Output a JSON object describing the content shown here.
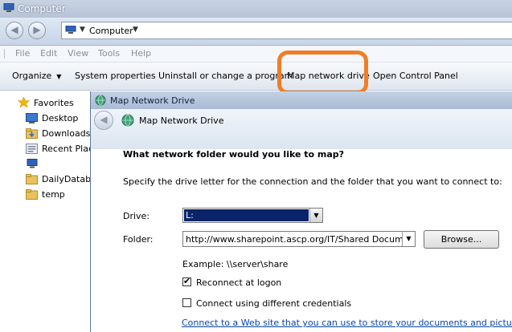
{
  "window": {
    "title": "Computer"
  },
  "address": {
    "location": "Computer"
  },
  "menu": [
    "File",
    "Edit",
    "View",
    "Tools",
    "Help"
  ],
  "commands": {
    "organize": "Organize",
    "system_properties": "System properties",
    "uninstall": "Uninstall or change a program",
    "map_drive": "Map network drive",
    "control_panel": "Open Control Panel"
  },
  "nav": {
    "favorites": "Favorites",
    "items": [
      "Desktop",
      "Downloads",
      "Recent Places",
      "",
      "DailyDatabase",
      "temp"
    ]
  },
  "dialog": {
    "title": "Map Network Drive",
    "header": "Map Network Drive",
    "question": "What network folder would you like to map?",
    "instructions": "Specify the drive letter for the connection and the folder that you want to connect to:",
    "drive_label": "Drive:",
    "drive_value": "L:",
    "folder_label": "Folder:",
    "folder_value": "http://www.sharepoint.ascp.org/IT/Shared Documents",
    "browse": "Browse...",
    "example": "Example: \\\\server\\share",
    "reconnect": "Reconnect at logon",
    "reconnect_checked": true,
    "different_credentials": "Connect using different credentials",
    "different_credentials_checked": false,
    "link": "Connect to a Web site that you can use to store your documents and pictures."
  },
  "highlight_color": "#f07e26"
}
